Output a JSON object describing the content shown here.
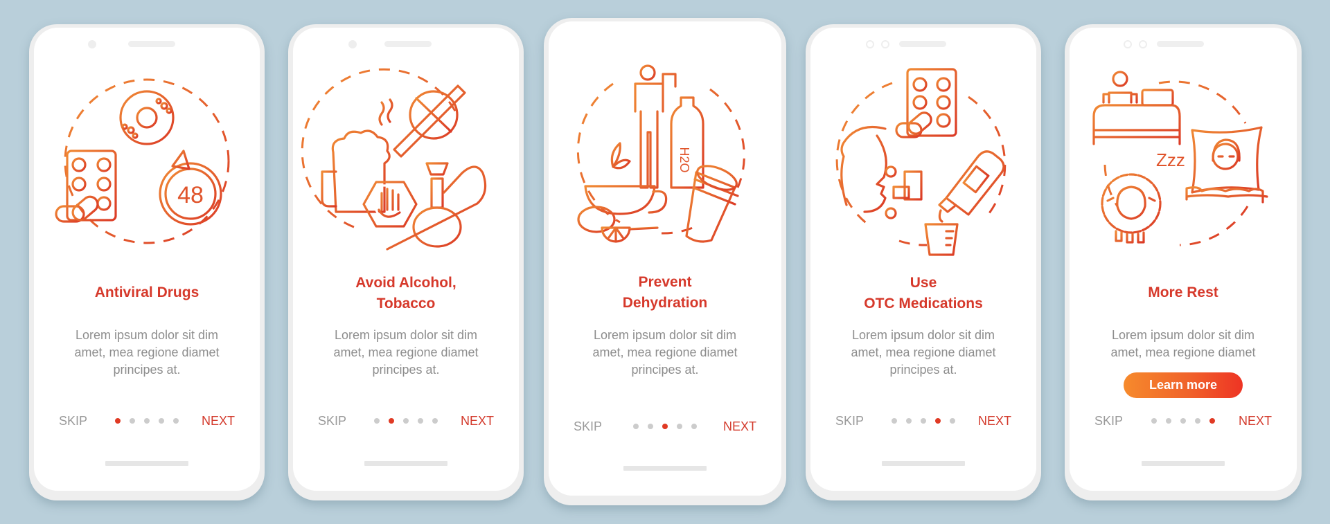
{
  "colors": {
    "background": "#b9cfda",
    "title": "#d6392b",
    "body_text": "#8d8d8d",
    "skip": "#9a9a9a",
    "next": "#d33a2c",
    "dot_inactive": "#cccccc",
    "dot_active": "#e03a24",
    "icon_gradient_start": "#f08a35",
    "icon_gradient_end": "#db3a26",
    "button_gradient_start": "#f68a2c",
    "button_gradient_end": "#ee3424"
  },
  "screens": [
    {
      "title_lines": [
        "Antiviral Drugs"
      ],
      "body_lines": [
        "Lorem ipsum dolor sit dim",
        "amet, mea regione diamet",
        "principes at."
      ],
      "skip_label": "SKIP",
      "next_label": "NEXT",
      "page_index": 1,
      "page_count": 5,
      "illustration": [
        "virus-target-icon",
        "pill-blister-icon",
        "capsules-icon",
        "48-hour-timer-icon"
      ],
      "timer_text": "48"
    },
    {
      "title_lines": [
        "Avoid Alcohol,",
        "Tobacco"
      ],
      "body_lines": [
        "Lorem ipsum dolor sit dim",
        "amet, mea regione diamet",
        "principes at."
      ],
      "skip_label": "SKIP",
      "next_label": "NEXT",
      "page_index": 2,
      "page_count": 5,
      "illustration": [
        "no-smoking-icon",
        "beer-mug-icon",
        "stop-hand-icon",
        "hookah-icon"
      ]
    },
    {
      "title_lines": [
        "Prevent",
        "Dehydration"
      ],
      "body_lines": [
        "Lorem ipsum dolor sit dim",
        "amet, mea regione diamet",
        "principes at."
      ],
      "skip_label": "SKIP",
      "next_label": "NEXT",
      "page_index": 3,
      "page_count": 5,
      "illustration": [
        "person-drinking-icon",
        "water-bottle-icon",
        "tea-cup-lemon-icon",
        "coffee-cup-icon"
      ],
      "bottle_label": "H2O"
    },
    {
      "title_lines": [
        "Use",
        "OTC Medications"
      ],
      "body_lines": [
        "Lorem ipsum dolor sit dim",
        "amet, mea regione diamet",
        "principes at."
      ],
      "skip_label": "SKIP",
      "next_label": "NEXT",
      "page_index": 4,
      "page_count": 5,
      "illustration": [
        "pill-blister-icon",
        "inhaler-face-icon",
        "syrup-bottle-icon",
        "measuring-cup-icon"
      ]
    },
    {
      "title_lines": [
        "More Rest"
      ],
      "body_lines": [
        "Lorem ipsum dolor sit dim",
        "amet, mea regione diamet"
      ],
      "button_label": "Learn more",
      "skip_label": "SKIP",
      "next_label": "NEXT",
      "page_index": 5,
      "page_count": 5,
      "illustration": [
        "person-in-bed-icon",
        "sleeping-woman-icon",
        "sheep-icon",
        "zzz-icon"
      ],
      "zzz_text": "Zzz"
    }
  ]
}
